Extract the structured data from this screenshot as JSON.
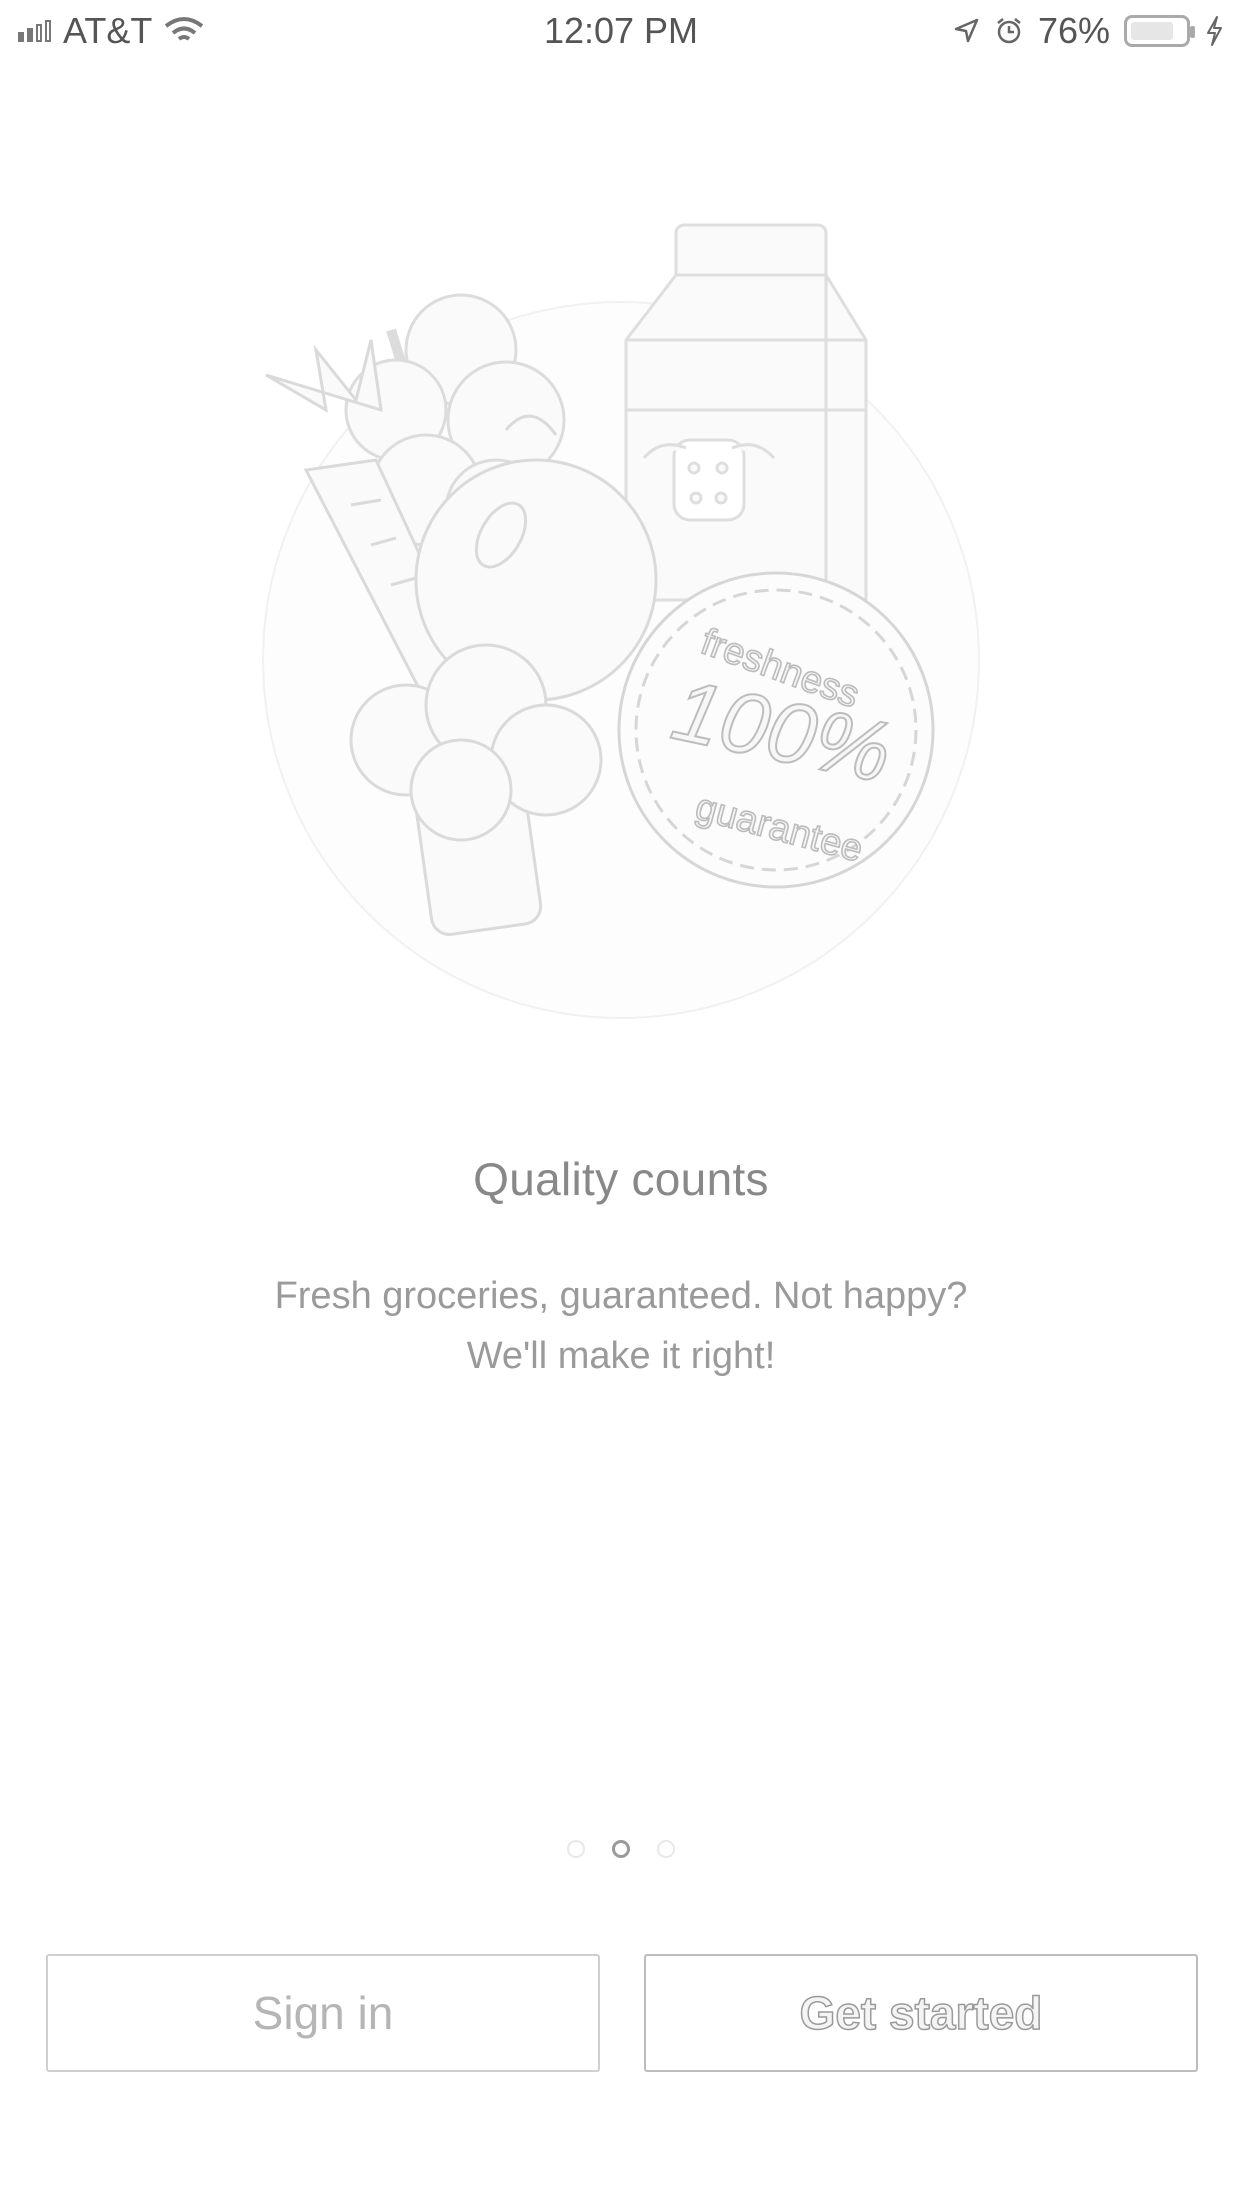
{
  "status_bar": {
    "carrier": "AT&T",
    "time": "12:07 PM",
    "battery_percent": "76%",
    "icons": [
      "signal-icon",
      "wifi-icon",
      "location-arrow-icon",
      "alarm-icon",
      "battery-icon",
      "charging-bolt-icon"
    ]
  },
  "illustration": {
    "badge_top": "freshness",
    "badge_center": "100%",
    "badge_bottom": "guarantee",
    "icon": "groceries-illustration"
  },
  "onboarding": {
    "title": "Quality counts",
    "body": "Fresh groceries, guaranteed. Not happy? We'll make it right!",
    "page_indicator": {
      "total": 3,
      "active_index": 1
    }
  },
  "actions": {
    "sign_in": "Sign in",
    "get_started": "Get started"
  },
  "colors": {
    "background": "#ffffff",
    "text": "#8a8a8a",
    "border": "#cfcfcf"
  }
}
